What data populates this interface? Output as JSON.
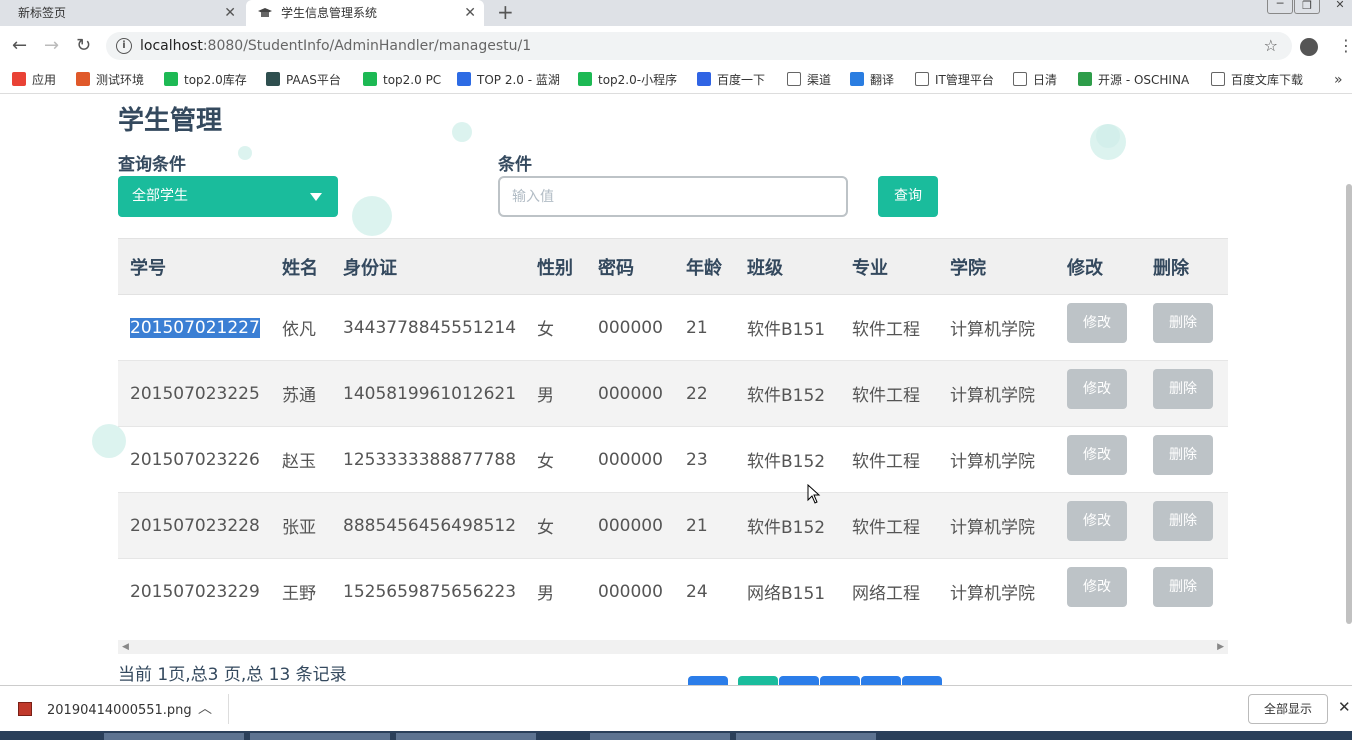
{
  "browser": {
    "tabs": [
      {
        "title": "新标签页"
      },
      {
        "title": "学生信息管理系统"
      }
    ],
    "close_glyph": "✕",
    "new_tab_glyph": "+",
    "url_host": "localhost",
    "url_rest": ":8080/StudentInfo/AdminHandler/managestu/1",
    "bookmarks": [
      {
        "label": "应用",
        "icon": "apps-grid-icon",
        "color": "#e94235"
      },
      {
        "label": "测试环境",
        "icon": "u-logo-icon",
        "color": "#e0592a"
      },
      {
        "label": "top2.0库存",
        "icon": "play-logo-icon",
        "color": "#1db954"
      },
      {
        "label": "PAAS平台",
        "icon": "globe-logo-icon",
        "color": "#2f4f4f"
      },
      {
        "label": "top2.0 PC",
        "icon": "play-logo-icon",
        "color": "#1db954"
      },
      {
        "label": "TOP 2.0 - 蓝湖",
        "icon": "lanhu-logo-icon",
        "color": "#2d6be4"
      },
      {
        "label": "top2.0-小程序",
        "icon": "play-logo-icon",
        "color": "#1db954"
      },
      {
        "label": "百度一下",
        "icon": "baidu-paw-icon",
        "color": "#3064e4"
      },
      {
        "label": "渠道",
        "icon": "page-icon",
        "color": "#ffffff"
      },
      {
        "label": "翻译",
        "icon": "translate-logo-icon",
        "color": "#2a7de1"
      },
      {
        "label": "IT管理平台",
        "icon": "page-icon",
        "color": "#ffffff"
      },
      {
        "label": "日清",
        "icon": "page-icon",
        "color": "#ffffff"
      },
      {
        "label": "开源 - OSCHINA",
        "icon": "oschina-logo-icon",
        "color": "#2e9d4a"
      },
      {
        "label": "百度文库下载",
        "icon": "page-icon",
        "color": "#ffffff"
      }
    ],
    "more_glyph": "»"
  },
  "page": {
    "title": "学生管理",
    "query_label": "查询条件",
    "condition_label": "条件",
    "select_value": "全部学生",
    "input_placeholder": "输入值",
    "query_button": "查询",
    "accent_color": "#1abc9c",
    "headers": [
      "学号",
      "姓名",
      "身份证",
      "性别",
      "密码",
      "年龄",
      "班级",
      "专业",
      "学院",
      "修改",
      "删除"
    ],
    "rows": [
      [
        "201507021227",
        "依凡",
        "3443778845551214",
        "女",
        "000000",
        "21",
        "软件B151",
        "软件工程",
        "计算机学院"
      ],
      [
        "201507023225",
        "苏通",
        "1405819961012621",
        "男",
        "000000",
        "22",
        "软件B152",
        "软件工程",
        "计算机学院"
      ],
      [
        "201507023226",
        "赵玉",
        "1253333388877788",
        "女",
        "000000",
        "23",
        "软件B152",
        "软件工程",
        "计算机学院"
      ],
      [
        "201507023228",
        "张亚",
        "8885456456498512",
        "女",
        "000000",
        "21",
        "软件B152",
        "软件工程",
        "计算机学院"
      ],
      [
        "201507023229",
        "王野",
        "1525659875656223",
        "男",
        "000000",
        "24",
        "网络B151",
        "网络工程",
        "计算机学院"
      ]
    ],
    "edit_label": "修改",
    "delete_label": "删除",
    "page_info": "当前 1页,总3 页,总 13 条记录"
  },
  "download": {
    "filename": "20190414000551.png",
    "show_all": "全部显示"
  }
}
